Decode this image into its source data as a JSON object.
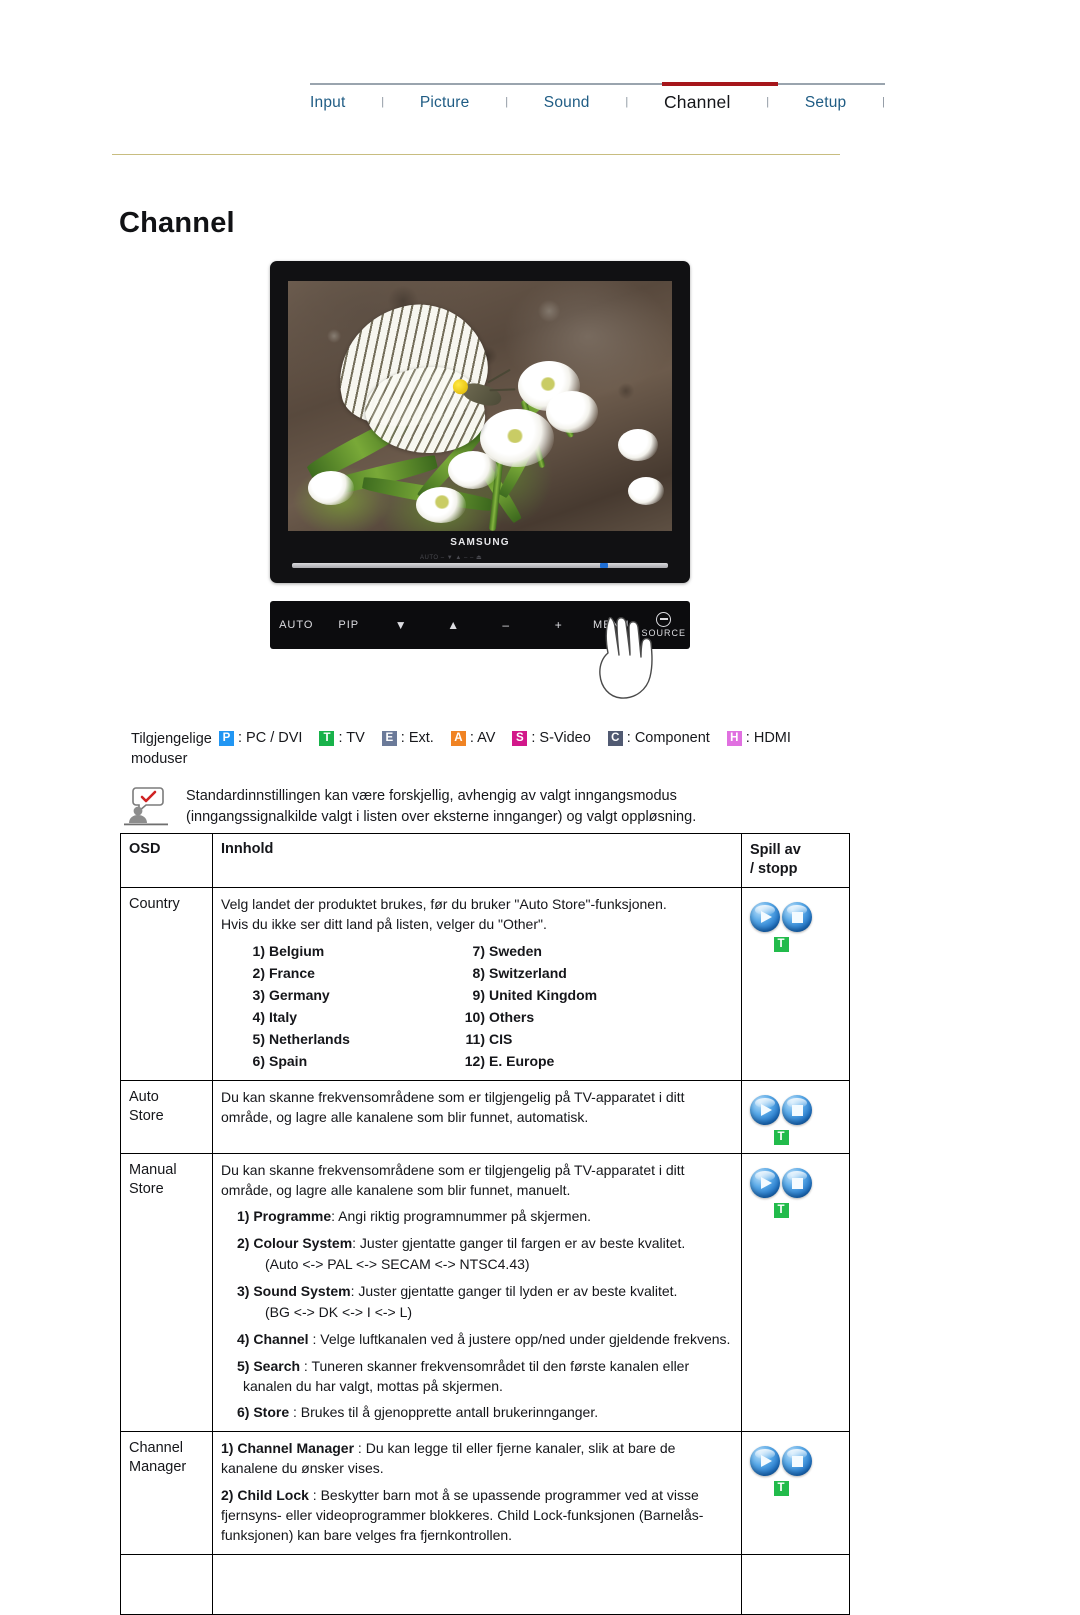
{
  "nav": {
    "separator": "|",
    "items": [
      {
        "label": "Input",
        "active": false
      },
      {
        "label": "Picture",
        "active": false
      },
      {
        "label": "Sound",
        "active": false
      },
      {
        "label": "Channel",
        "active": true
      },
      {
        "label": "Setup",
        "active": false
      }
    ]
  },
  "page": {
    "title": "Channel"
  },
  "monitor": {
    "brand": "SAMSUNG",
    "faint_keys": "AUTO  –  ▼  ▲  –  –  ⏏",
    "controls": [
      "AUTO",
      "PIP",
      "▼",
      "▲",
      "–",
      "+",
      "MENU"
    ],
    "source_label": "SOURCE"
  },
  "modes": {
    "label": "Tilgjengelige moduser",
    "items": [
      {
        "key": "P",
        "text": ": PC / DVI",
        "color": "#2196f3"
      },
      {
        "key": "T",
        "text": ": TV",
        "color": "#18b24a"
      },
      {
        "key": "E",
        "text": ": Ext.",
        "color": "#6b7a99"
      },
      {
        "key": "A",
        "text": ": AV",
        "color": "#f08323"
      },
      {
        "key": "S",
        "text": ": S-Video",
        "color": "#d2188a"
      },
      {
        "key": "C",
        "text": ": Component",
        "color": "#515a72"
      },
      {
        "key": "H",
        "text": ": HDMI",
        "color": "#e070e0"
      }
    ]
  },
  "note": {
    "line1": "Standardinnstillingen kan være forskjellig, avhengig av valgt inngangsmodus",
    "line2": "(inngangssignalkilde valgt i listen over eksterne innganger) og valgt oppløsning."
  },
  "table": {
    "headers": {
      "osd": "OSD",
      "content": "Innhold",
      "play_line1": "Spill av",
      "play_line2": "/ stopp"
    },
    "rows": {
      "country": {
        "osd": "Country",
        "line1": "Velg landet der produktet brukes, før du bruker \"Auto Store\"-funksjonen.",
        "line2": "Hvis du ikke ser ditt land på listen, velger du \"Other\".",
        "countries_left": [
          {
            "n": "1)",
            "name": "Belgium"
          },
          {
            "n": "2)",
            "name": "France"
          },
          {
            "n": "3)",
            "name": "Germany"
          },
          {
            "n": "4)",
            "name": "Italy"
          },
          {
            "n": "5)",
            "name": "Netherlands"
          },
          {
            "n": "6)",
            "name": "Spain"
          }
        ],
        "countries_right": [
          {
            "n": "7)",
            "name": "Sweden"
          },
          {
            "n": "8)",
            "name": "Switzerland"
          },
          {
            "n": "9)",
            "name": "United Kingdom"
          },
          {
            "n": "10)",
            "name": "Others"
          },
          {
            "n": "11)",
            "name": "CIS"
          },
          {
            "n": "12)",
            "name": "E. Europe"
          }
        ],
        "badge": "T"
      },
      "auto_store": {
        "osd_line1": "Auto",
        "osd_line2": "Store",
        "line1": "Du kan skanne frekvensområdene som er tilgjengelig på TV-apparatet i ditt",
        "line2": "område, og lagre alle kanalene som blir funnet, automatisk.",
        "badge": "T"
      },
      "manual_store": {
        "osd_line1": "Manual",
        "osd_line2": "Store",
        "line1": "Du kan skanne frekvensområdene som er tilgjengelig på TV-apparatet i ditt",
        "line2": "område, og lagre alle kanalene som blir funnet, manuelt.",
        "items": [
          {
            "num": "1)",
            "term": "Programme",
            "text": ": Angi riktig programnummer på skjermen.",
            "cont": ""
          },
          {
            "num": "2)",
            "term": "Colour System",
            "text": ": Juster gjentatte ganger til fargen er av beste kvalitet.",
            "cont": "(Auto <-> PAL <-> SECAM <-> NTSC4.43)"
          },
          {
            "num": "3)",
            "term": "Sound System",
            "text": ": Juster gjentatte ganger til lyden er av beste kvalitet.",
            "cont": "(BG <-> DK <-> I <-> L)"
          },
          {
            "num": "4)",
            "term": "Channel",
            "text": " : Velge luftkanalen ved å justere opp/ned under gjeldende frekvens.",
            "cont": ""
          },
          {
            "num": "5)",
            "term": "Search",
            "text": " : Tuneren skanner frekvensområdet til den første kanalen eller kanalen du har valgt, mottas på skjermen.",
            "cont": ""
          },
          {
            "num": "6)",
            "term": "Store",
            "text": " : Brukes til å gjenopprette antall brukerinnganger.",
            "cont": ""
          }
        ],
        "badge": "T"
      },
      "channel_manager": {
        "osd_line1": "Channel",
        "osd_line2": "Manager",
        "items": [
          {
            "num": "1)",
            "term": "Channel Manager",
            "text": " : Du kan legge til eller fjerne kanaler, slik at bare de kanalene du ønsker vises."
          },
          {
            "num": "2)",
            "term": "Child Lock",
            "text": " : Beskytter barn mot å se upassende programmer ved at visse fjernsyns- eller videoprogrammer blokkeres. Child Lock-funksjonen (Barnelås-funksjonen) kan bare velges fra fjernkontrollen."
          }
        ],
        "badge": "T"
      }
    }
  }
}
